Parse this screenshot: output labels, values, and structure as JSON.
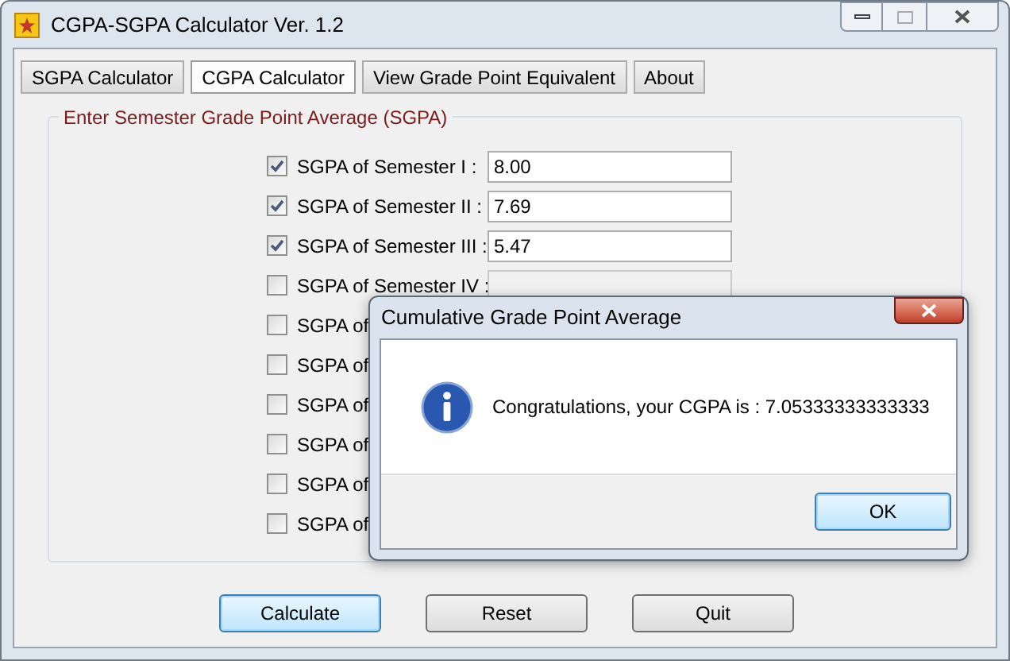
{
  "window": {
    "title": "CGPA-SGPA Calculator Ver. 1.2"
  },
  "tabs": [
    {
      "label": "SGPA Calculator",
      "selected": false
    },
    {
      "label": "CGPA Calculator",
      "selected": true
    },
    {
      "label": "View Grade Point Equivalent",
      "selected": false
    },
    {
      "label": "About",
      "selected": false
    }
  ],
  "group": {
    "title": "Enter Semester Grade Point Average (SGPA)"
  },
  "rows": [
    {
      "label": "SGPA of Semester I :",
      "checked": true,
      "field": {
        "value": "8.00",
        "disabled": false
      }
    },
    {
      "label": "SGPA of Semester II :",
      "checked": true,
      "field": {
        "value": "7.69",
        "disabled": false
      }
    },
    {
      "label": "SGPA of Semester III :",
      "checked": true,
      "field": {
        "value": "5.47",
        "disabled": false
      }
    },
    {
      "label": "SGPA of Semester IV :",
      "checked": false,
      "field": {
        "disabled": true
      }
    },
    {
      "label": "SGPA of",
      "checked": false
    },
    {
      "label": "SGPA of",
      "checked": false
    },
    {
      "label": "SGPA of",
      "checked": false
    },
    {
      "label": "SGPA of",
      "checked": false
    },
    {
      "label": "SGPA of",
      "checked": false
    },
    {
      "label": "SGPA of",
      "checked": false
    }
  ],
  "buttons": [
    {
      "label": "Calculate",
      "selected": true
    },
    {
      "label": "Reset",
      "selected": false
    },
    {
      "label": "Quit",
      "selected": false
    }
  ],
  "dialog": {
    "title": "Cumulative Grade Point Average",
    "message": "Congratulations, your CGPA is : 7.05333333333333",
    "button": "OK"
  }
}
